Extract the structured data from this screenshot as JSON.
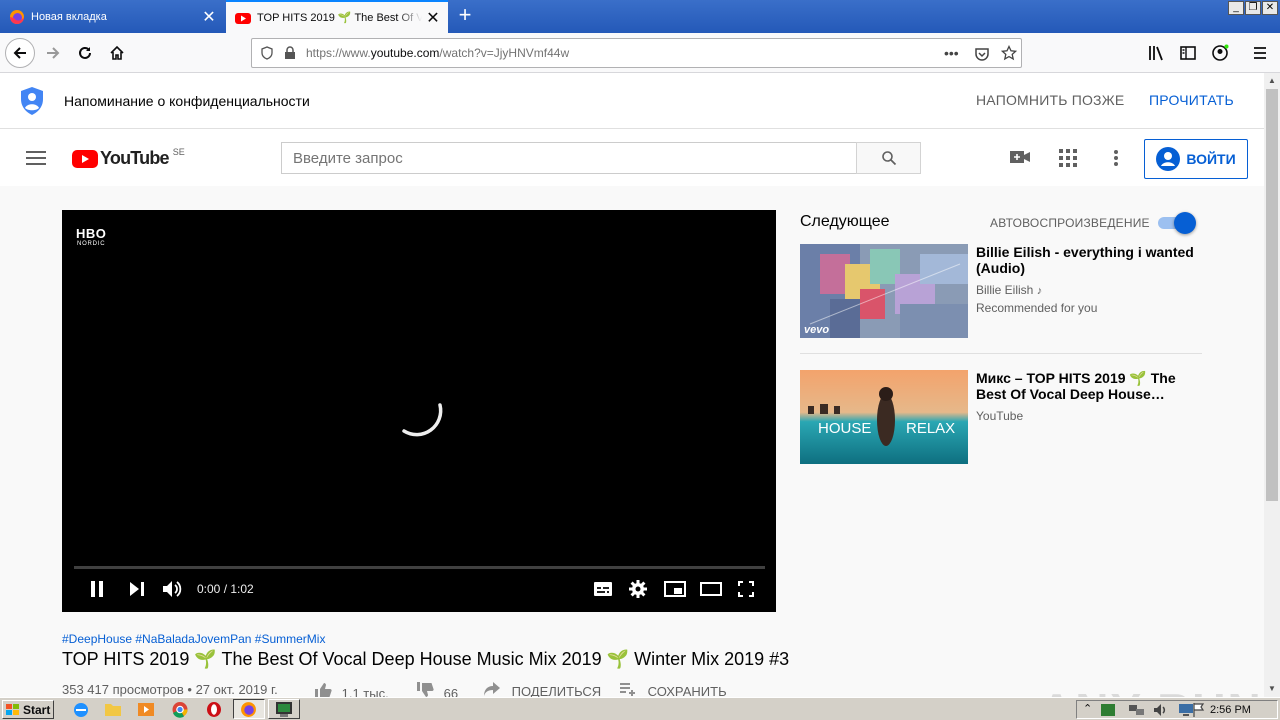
{
  "browser": {
    "tabs": [
      {
        "title": "Новая вкладка",
        "active": false
      },
      {
        "title": "TOP HITS 2019 🌱 The Best Of Vocal Deep House",
        "active": true
      }
    ],
    "url_prefix": "https://www.",
    "url_domain": "youtube.com",
    "url_rest": "/watch?v=JjyHNVmf44w"
  },
  "privacy_banner": {
    "text": "Напоминание о конфиденциальности",
    "later_label": "НАПОМНИТЬ ПОЗЖЕ",
    "read_label": "ПРОЧИТАТЬ"
  },
  "masthead": {
    "logo_text": "YouTube",
    "region": "SE",
    "search_placeholder": "Введите запрос",
    "signin_label": "ВОЙТИ"
  },
  "player": {
    "channel_logo": "HBO",
    "channel_sub": "NORDIC",
    "time": "0:00 / 1:02",
    "progress": 0
  },
  "video": {
    "hashtags": "#DeepHouse #NaBaladaJovemPan #SummerMix",
    "title": "TOP HITS 2019 🌱 The Best Of Vocal Deep House Music Mix 2019 🌱 Winter Mix 2019 #3",
    "meta": "353 417 просмотров • 27 окт. 2019 г.",
    "likes": "1,1 тыс.",
    "dislikes": "66",
    "share_label": "ПОДЕЛИТЬСЯ",
    "save_label": "СОХРАНИТЬ"
  },
  "upnext": {
    "heading": "Следующее",
    "autoplay_label": "АВТОВОСПРОИЗВЕДЕНИЕ",
    "autoplay_on": true,
    "items": [
      {
        "title": "Billie Eilish - everything i wanted (Audio)",
        "channel": "Billie Eilish",
        "note": "Recommended for you",
        "badge": "vevo"
      },
      {
        "title": "Микс – TOP HITS 2019 🌱 The Best Of Vocal Deep House…",
        "channel": "YouTube",
        "thumb_left": "HOUSE",
        "thumb_right": "RELAX"
      }
    ]
  },
  "watermark": "ANY RUN",
  "taskbar": {
    "start_label": "Start",
    "clock": "2:56 PM"
  }
}
